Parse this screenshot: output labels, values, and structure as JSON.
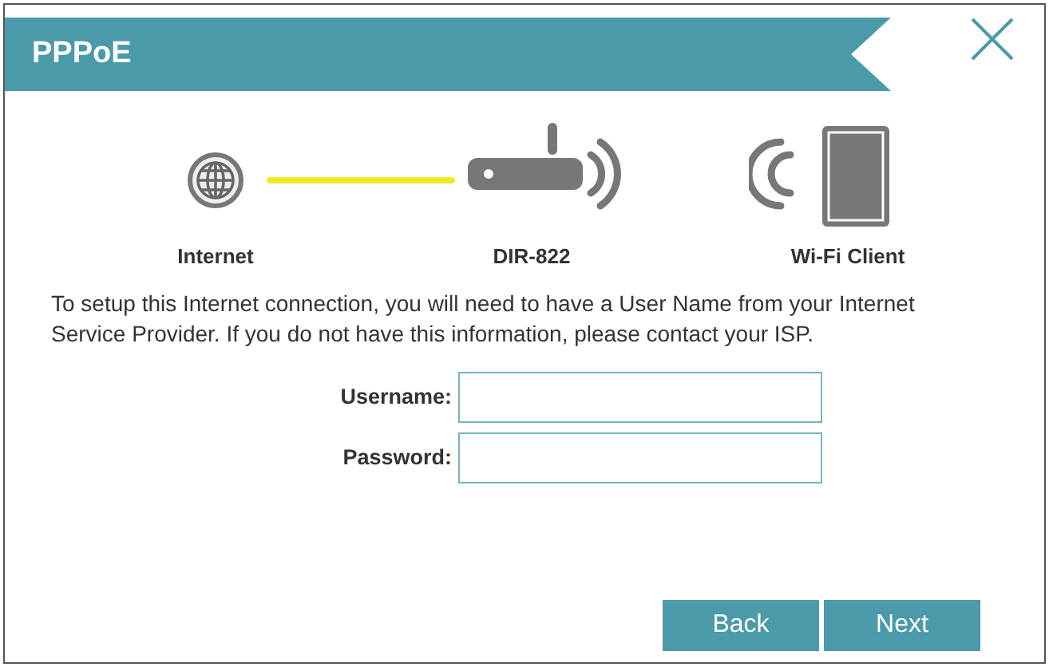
{
  "dialog": {
    "title": "PPPoE"
  },
  "diagram": {
    "nodes": [
      {
        "kind": "internet",
        "label": "Internet"
      },
      {
        "kind": "router",
        "label": "DIR-822"
      },
      {
        "kind": "client",
        "label": "Wi-Fi Client"
      }
    ]
  },
  "message": "To setup this Internet connection, you will need to have a User Name from your Internet Service Provider. If you do not have this information, please contact your ISP.",
  "fields": [
    {
      "label": "Username:"
    },
    {
      "label": "Password:"
    }
  ],
  "buttons": [
    {
      "label": "Back"
    },
    {
      "label": "Next"
    }
  ]
}
